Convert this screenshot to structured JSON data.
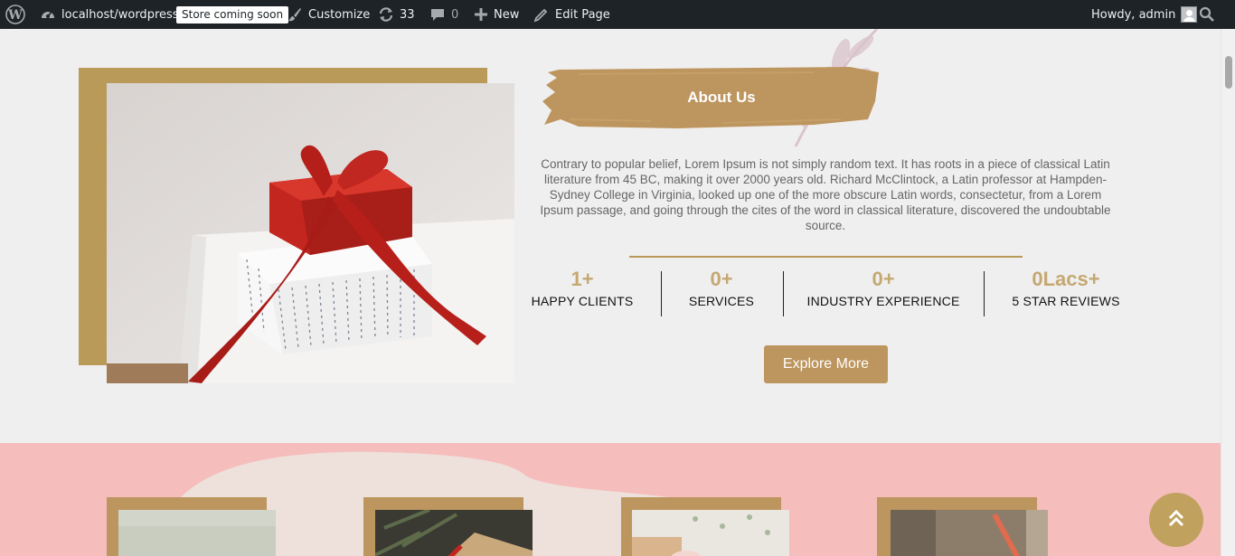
{
  "adminbar": {
    "site_name": "localhost/wordpress",
    "store_badge": "Store coming soon",
    "customize": "Customize",
    "updates_count": "33",
    "comments_count": "0",
    "new_label": "New",
    "edit_page": "Edit Page",
    "howdy": "Howdy, admin"
  },
  "about": {
    "title": "About Us",
    "body": "Contrary to popular belief, Lorem Ipsum is not simply random text. It has roots in a piece of classical Latin literature from 45 BC, making it over 2000 years old. Richard McClintock, a Latin professor at Hampden-Sydney College in Virginia, looked up one of the more obscure Latin words, consectetur, from a Lorem Ipsum passage, and going through the cites of the word in classical literature, discovered the undoubtable source.",
    "stats": [
      {
        "value": "1+",
        "label": "HAPPY CLIENTS"
      },
      {
        "value": "0+",
        "label": "SERVICES"
      },
      {
        "value": "0+",
        "label": "INDUSTRY EXPERIENCE"
      },
      {
        "value": "0Lacs+",
        "label": "5 STAR REVIEWS"
      }
    ],
    "button": "Explore More"
  },
  "colors": {
    "accent_gold": "#b99a58",
    "button": "#bd955e",
    "pink_section": "#f5bdbc",
    "adminbar": "#1d2327"
  },
  "icons": {
    "wp_logo": "wordpress-icon",
    "dashboard": "dashboard-icon",
    "customize": "brush-icon",
    "updates": "refresh-icon",
    "comments": "comment-icon",
    "new": "plus-icon",
    "edit": "pencil-icon",
    "search": "search-icon",
    "back_to_top": "double-chevron-up-icon"
  }
}
